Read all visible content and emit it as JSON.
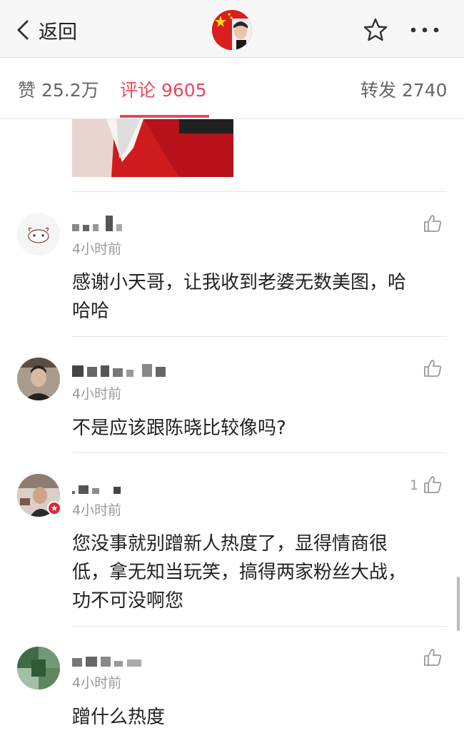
{
  "nav": {
    "back_label": "返回",
    "icons": {
      "back": "chevron-left-icon",
      "star": "star-icon",
      "more": "more-icon"
    }
  },
  "tabs": {
    "likes": "赞 25.2万",
    "comments": "评论 9605",
    "reposts": "转发 2740",
    "active_color": "#e9485b"
  },
  "comments": [
    {
      "time": "4小时前",
      "text_lines": [
        "感谢小天哥，让我收到老婆无数美图，哈",
        "哈哈"
      ],
      "like_count": ""
    },
    {
      "time": "4小时前",
      "text_lines": [
        "不是应该跟陈晓比较像吗?"
      ],
      "like_count": ""
    },
    {
      "time": "4小时前",
      "text_lines": [
        "您没事就别蹭新人热度了，显得情商很",
        "低，拿无知当玩笑，搞得两家粉丝大战，",
        "功不可没啊您"
      ],
      "like_count": "1"
    },
    {
      "time": "4小时前",
      "text_lines": [
        "蹭什么热度"
      ],
      "like_count": ""
    }
  ]
}
